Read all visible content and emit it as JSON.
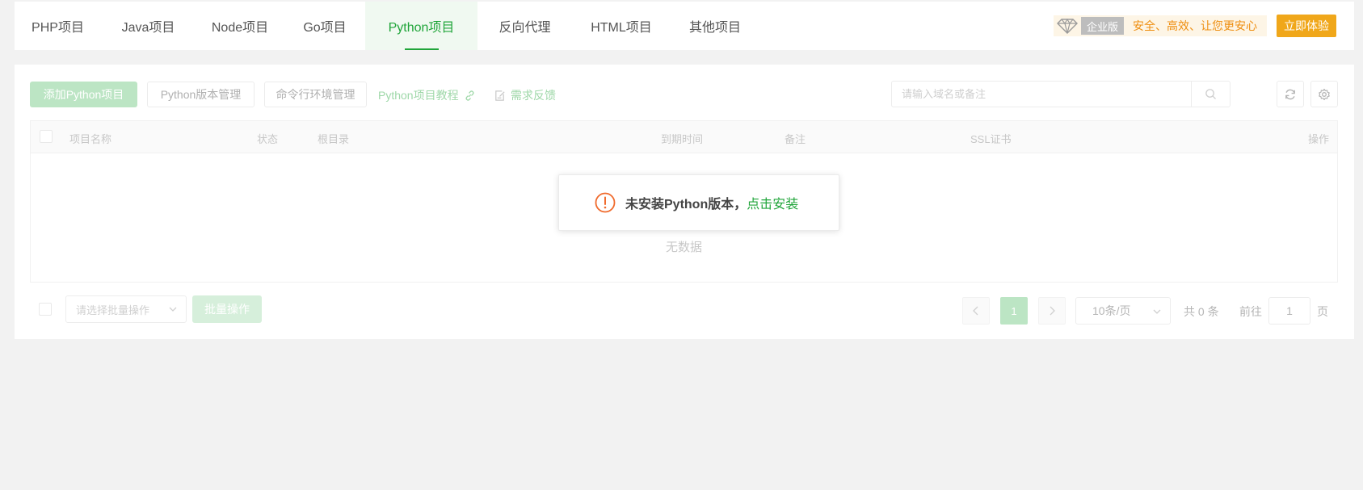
{
  "tabs": [
    {
      "label": "PHP项目",
      "active": false
    },
    {
      "label": "Java项目",
      "active": false
    },
    {
      "label": "Node项目",
      "active": false
    },
    {
      "label": "Go项目",
      "active": false
    },
    {
      "label": "Python项目",
      "active": true
    },
    {
      "label": "反向代理",
      "active": false
    },
    {
      "label": "HTML项目",
      "active": false
    },
    {
      "label": "其他项目",
      "active": false
    }
  ],
  "promo": {
    "edition_tag": "企业版",
    "slogan": "安全、高效、让您更安心",
    "try_button": "立即体验"
  },
  "toolbar": {
    "add_button": "添加Python项目",
    "version_button": "Python版本管理",
    "cli_button": "命令行环境管理",
    "tutorial_link": "Python项目教程",
    "feedback_link": "需求反馈",
    "search_placeholder": "请输入域名或备注"
  },
  "table": {
    "columns": [
      "项目名称",
      "状态",
      "根目录",
      "到期时间",
      "备注",
      "SSL证书",
      "操作"
    ],
    "rows": [],
    "empty_text": "无数据"
  },
  "footer": {
    "batch_select_placeholder": "请选择批量操作",
    "batch_button": "批量操作",
    "current_page": "1",
    "page_size": "10条/页",
    "total_text": "共 0 条",
    "goto_label": "前往",
    "goto_value": "1",
    "page_unit": "页"
  },
  "toast": {
    "message": "未安装Python版本，",
    "link": "点击安装"
  },
  "colors": {
    "brand": "#20a53a",
    "brand_light": "#bce5c4",
    "promo_text": "#ee8e10",
    "try_button": "#f0a71a",
    "warning": "#f06b2d"
  }
}
